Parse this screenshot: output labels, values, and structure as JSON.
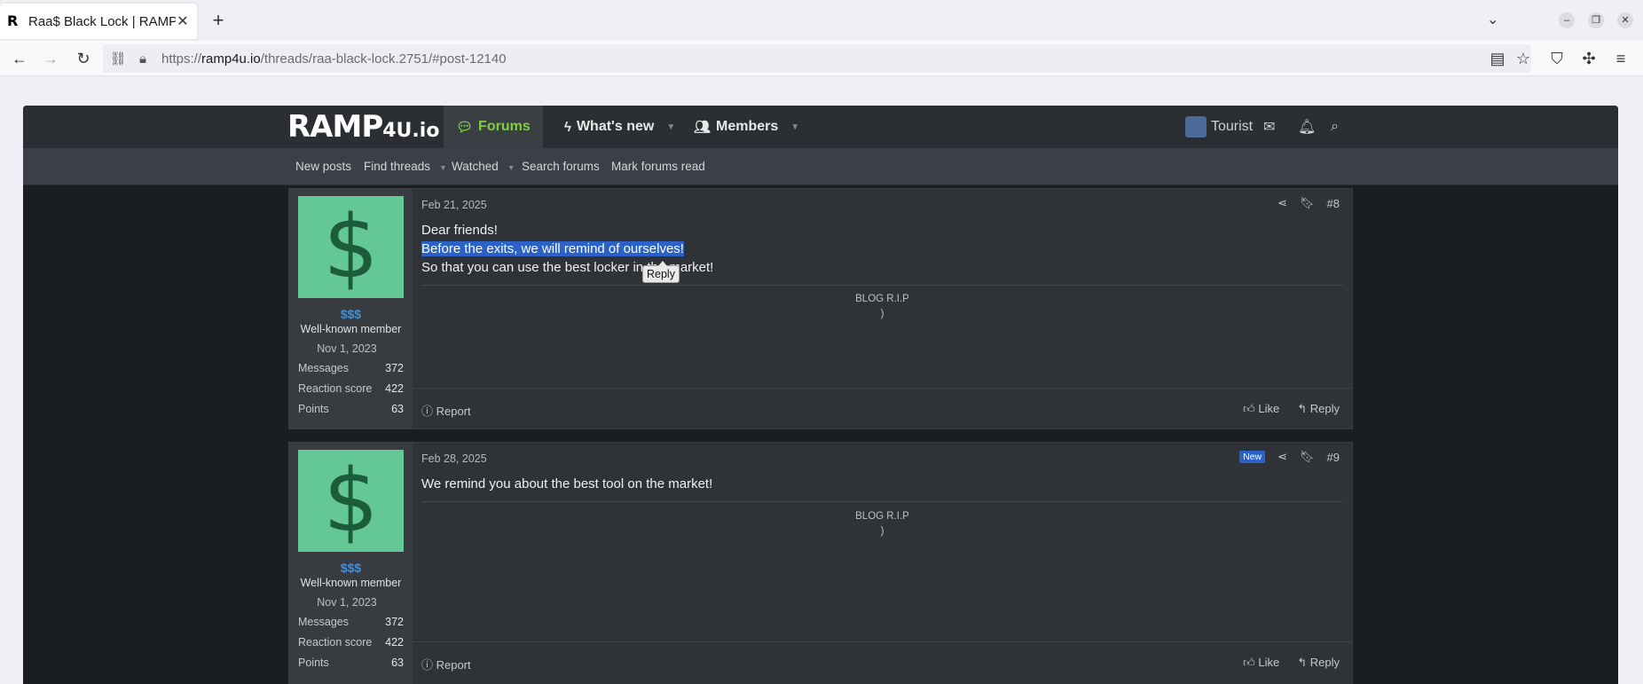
{
  "browser": {
    "tab_title": "Raa$ Black Lock | RAMP",
    "url_prefix": "https://",
    "url_host": "ramp4u.io",
    "url_path": "/threads/raa-black-lock.2751/#post-12140"
  },
  "site": {
    "logo_main": "RAMP",
    "logo_sub": "4U.io",
    "nav": {
      "forums": "Forums",
      "whats_new": "What's new",
      "members": "Members"
    },
    "user": "Tourist",
    "subnav": {
      "new_posts": "New posts",
      "find_threads": "Find threads",
      "watched": "Watched",
      "search_forums": "Search forums",
      "mark_read": "Mark forums read"
    }
  },
  "posts": [
    {
      "username": "$$$",
      "user_title": "Well-known member",
      "joined": "Nov 1, 2023",
      "stats": [
        {
          "label": "Messages",
          "value": "372"
        },
        {
          "label": "Reaction score",
          "value": "422"
        },
        {
          "label": "Points",
          "value": "63"
        }
      ],
      "date": "Feb 21, 2025",
      "number": "#8",
      "line1": "Dear friends!",
      "line2": "Before the exits, we will remind of ourselves!",
      "line3": "So that you can use the best locker in the market!",
      "tooltip": "Reply",
      "sig1": "BLOG R.I.P",
      "sig2": ")",
      "report": "Report",
      "like": "Like",
      "reply": "Reply"
    },
    {
      "username": "$$$",
      "user_title": "Well-known member",
      "joined": "Nov 1, 2023",
      "stats": [
        {
          "label": "Messages",
          "value": "372"
        },
        {
          "label": "Reaction score",
          "value": "422"
        },
        {
          "label": "Points",
          "value": "63"
        }
      ],
      "date": "Feb 28, 2025",
      "badge": "New",
      "number": "#9",
      "line1": "We remind you about the best tool on the market!",
      "sig1": "BLOG R.I.P",
      "sig2": ")",
      "report": "Report",
      "like": "Like",
      "reply": "Reply"
    }
  ]
}
